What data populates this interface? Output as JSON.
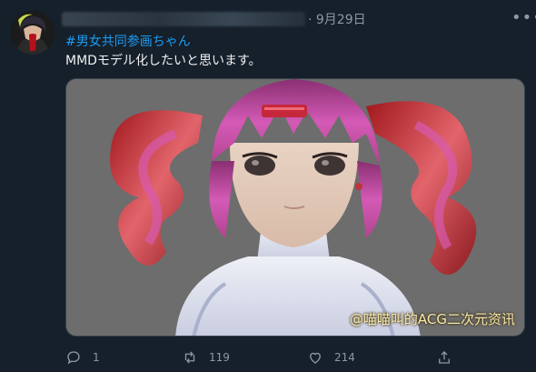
{
  "tweet": {
    "date": "· 9月29日",
    "more_icon": "ellipsis-icon",
    "hashtag": "#男女共同参画ちゃん",
    "text": "MMDモデル化したいと思います。",
    "media": {
      "watermark": "@喵喵叫的ACG二次元资讯"
    },
    "actions": {
      "reply_count": "1",
      "retweet_count": "119",
      "like_count": "214"
    }
  },
  "colors": {
    "background": "#15202b",
    "link": "#1d9bf0",
    "secondary_text": "#8b98a5"
  }
}
